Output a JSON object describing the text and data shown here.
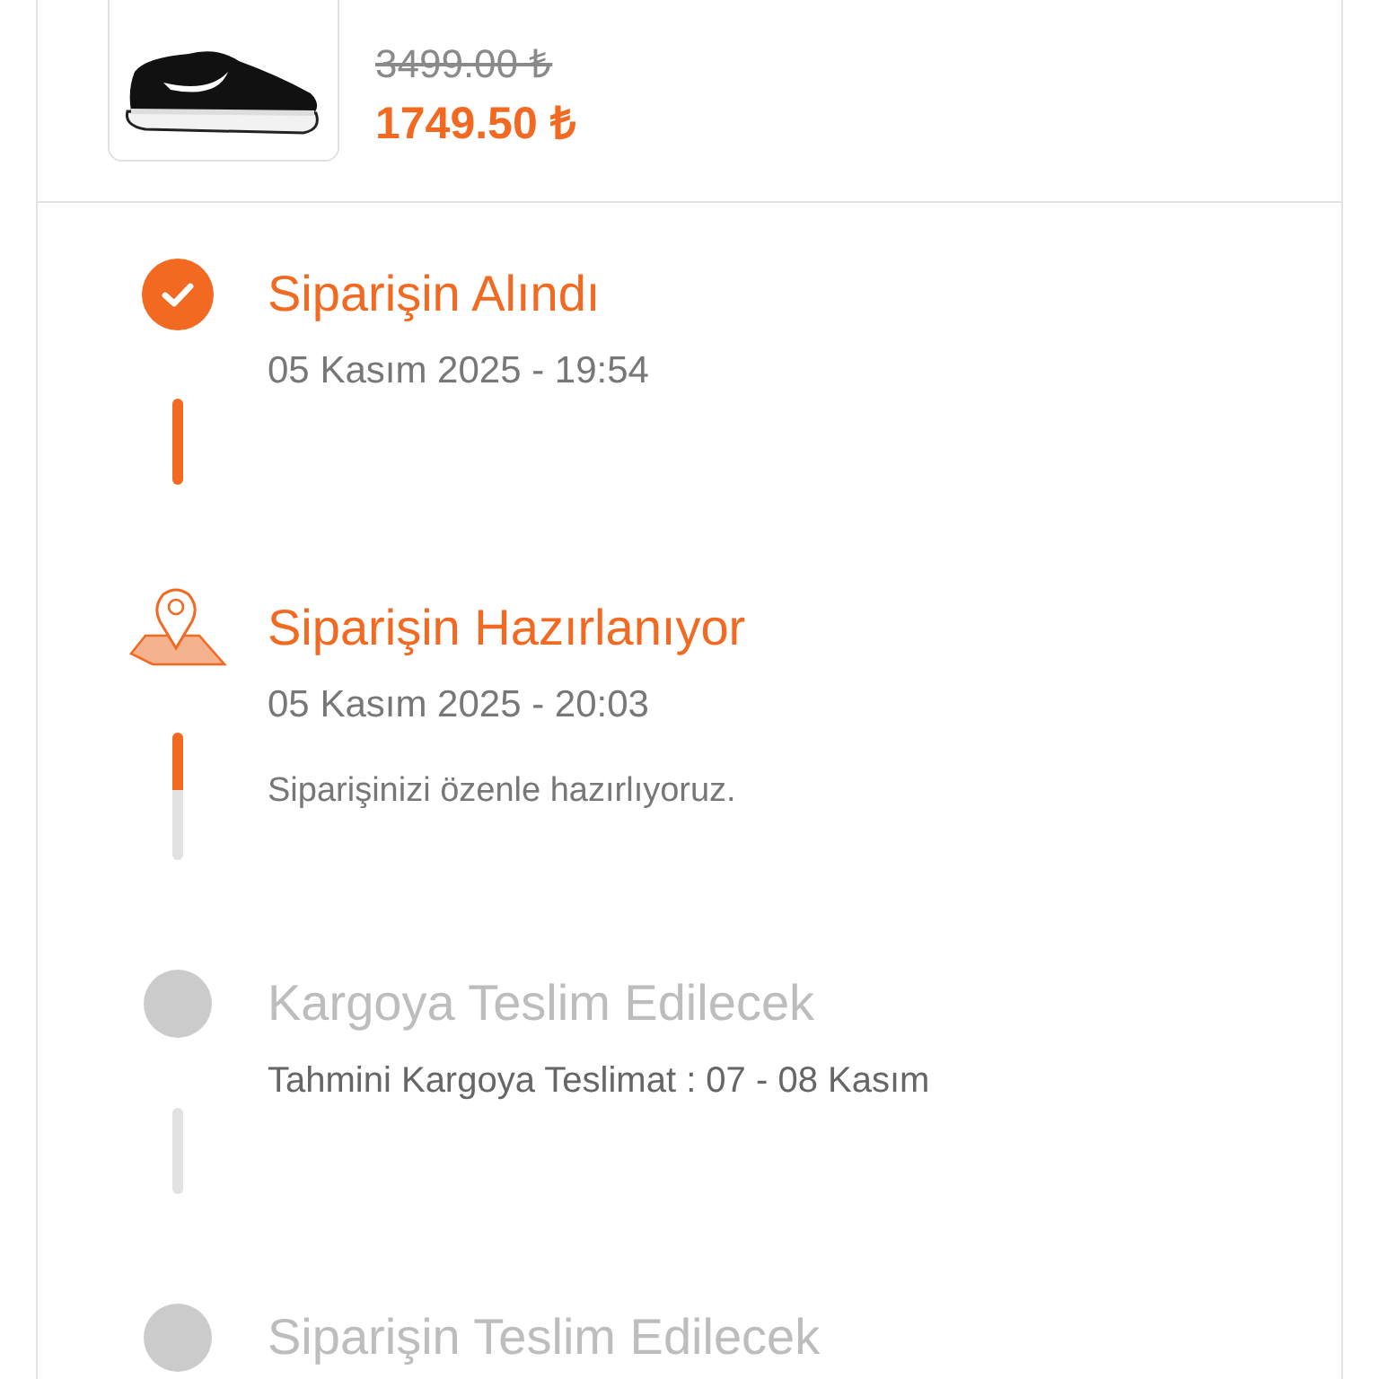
{
  "product": {
    "kind": "picture",
    "old_price": "3499.00 ₺",
    "price": "1749.50 ₺"
  },
  "steps": [
    {
      "title": "Siparişin Alındı",
      "subtitle": "05 Kasım 2025 - 19:54",
      "kind": "done",
      "level": 1
    },
    {
      "title": "Siparişin Hazırlanıyor",
      "subtitle": "05 Kasım 2025 - 20:03",
      "note": "Siparişinizi özenle hazırlıyoruz.",
      "kind": "active",
      "level": 0.45
    },
    {
      "title": "Kargoya Teslim Edilecek",
      "subtitle": "Tahmini Kargoya Teslimat : 07 - 08 Kasım",
      "kind": "pending",
      "level": 0
    },
    {
      "title": "Siparişin Teslim Edilecek",
      "kind": "pending"
    }
  ]
}
